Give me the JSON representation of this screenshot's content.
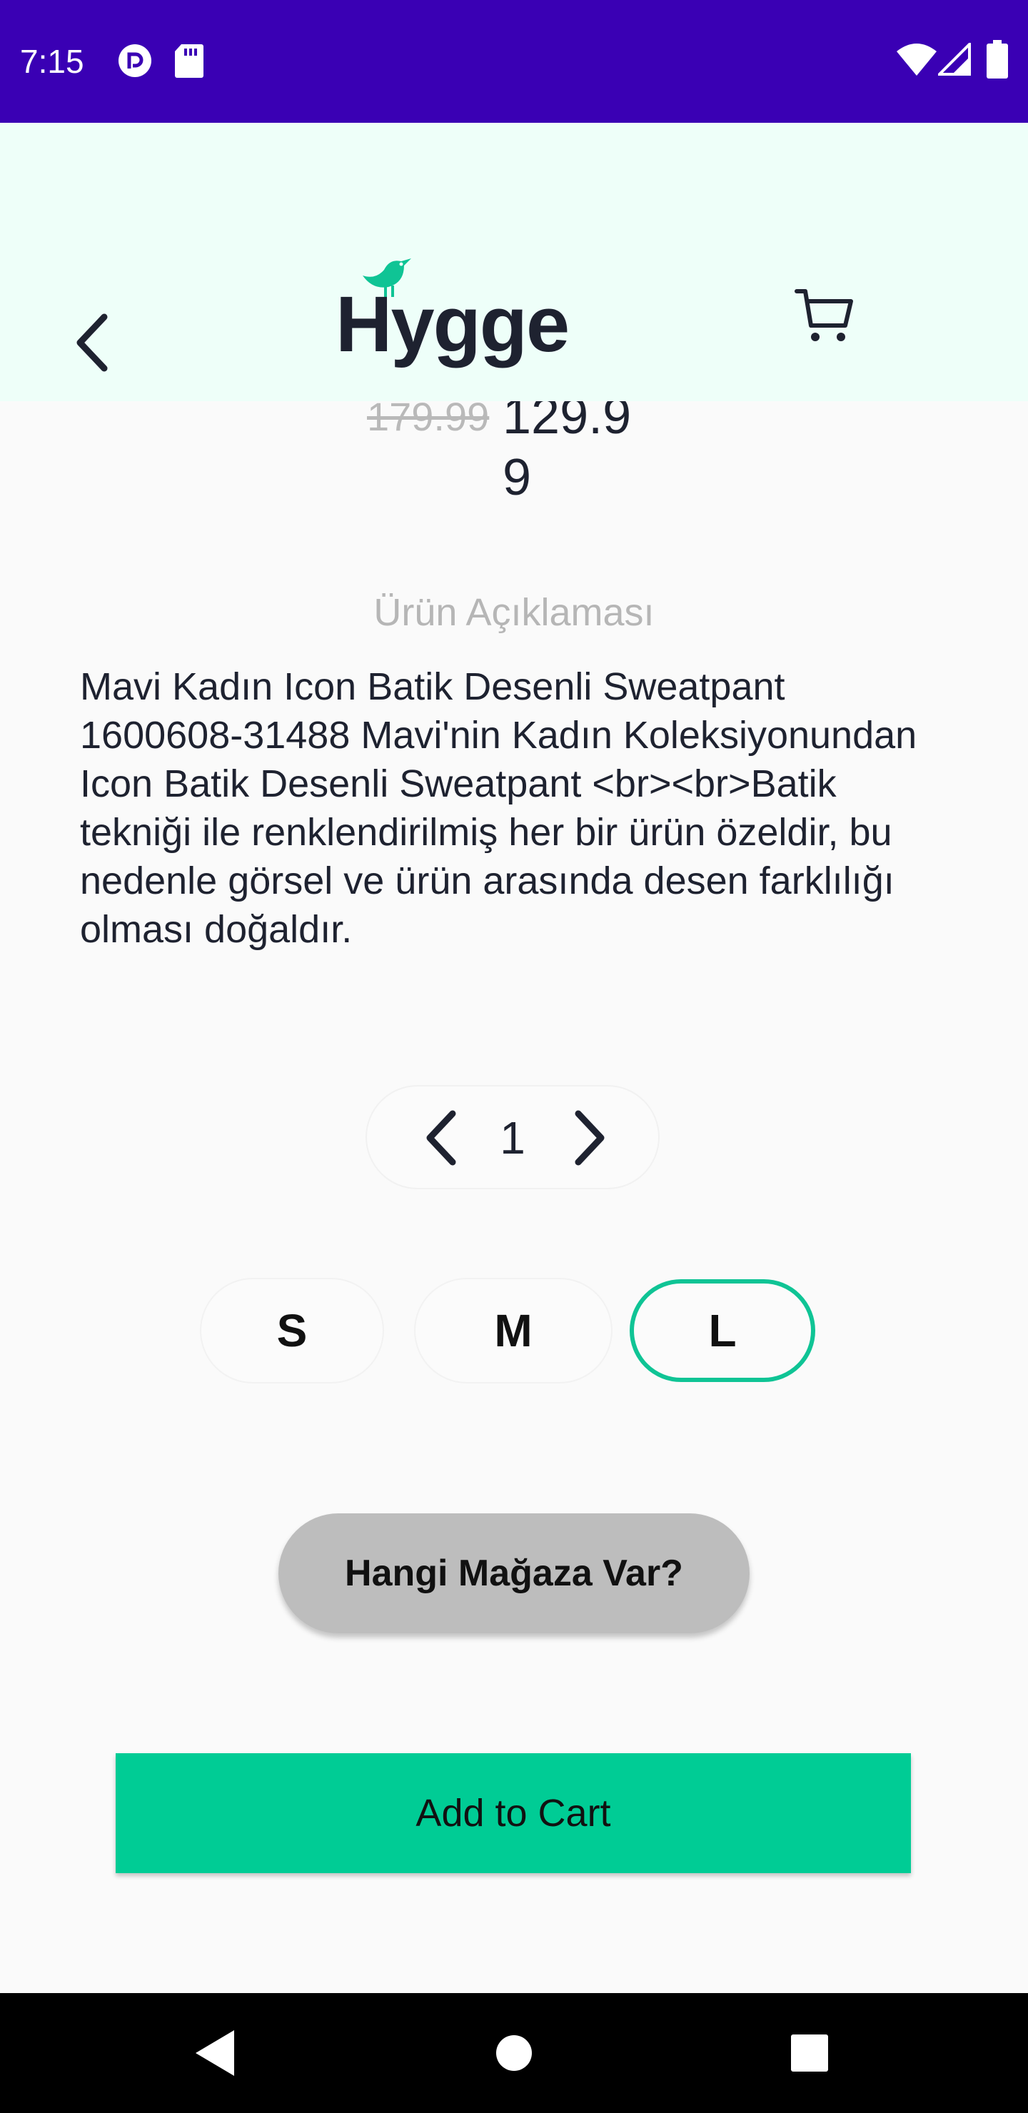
{
  "status_bar": {
    "time": "7:15",
    "icons_left": [
      "pocket-casts-icon",
      "sd-card-icon"
    ],
    "icons_right": [
      "wifi-icon",
      "signal-icon",
      "battery-icon"
    ],
    "color": "#3a00b4"
  },
  "header": {
    "logo_text": "Hygge",
    "accent": "#0fc495"
  },
  "product": {
    "old_price": "179.99",
    "new_price": "129.99",
    "description_title": "Ürün Açıklaması",
    "description": "Mavi Kadın Icon Batik Desenli Sweatpant 1600608-31488 Mavi'nin Kadın Koleksiyonundan Icon Batik Desenli Sweatpant <br><br>Batik tekniği ile renklendirilmiş her bir ürün özeldir, bu nedenle görsel ve ürün arasında desen farklılığı olması doğaldır."
  },
  "quantity": {
    "value": "1"
  },
  "sizes": {
    "options": [
      "S",
      "M",
      "L"
    ],
    "selected": "L"
  },
  "actions": {
    "store_label": "Hangi Mağaza Var?",
    "add_to_cart_label": "Add to Cart",
    "add_to_cart_color": "#00cc95"
  }
}
